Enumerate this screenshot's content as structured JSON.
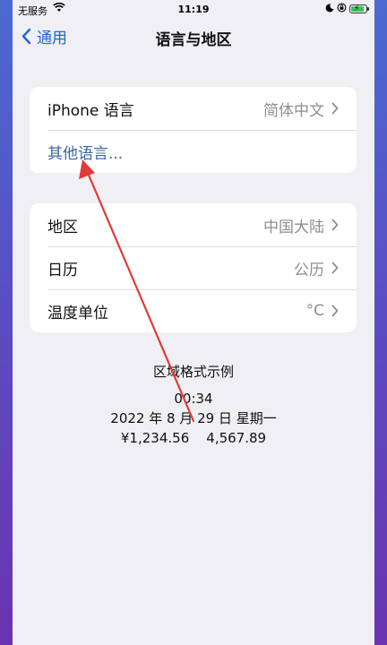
{
  "status_bar": {
    "carrier": "无服务",
    "time": "11:19",
    "battery_level": 0.85
  },
  "nav": {
    "back_label": "通用",
    "title": "语言与地区"
  },
  "language_group": {
    "rows": [
      {
        "label": "iPhone 语言",
        "value": "简体中文"
      },
      {
        "label": "其他语言..."
      }
    ]
  },
  "region_group": {
    "rows": [
      {
        "label": "地区",
        "value": "中国大陆"
      },
      {
        "label": "日历",
        "value": "公历"
      },
      {
        "label": "温度单位",
        "value": "°C"
      }
    ]
  },
  "format_example": {
    "title": "区域格式示例",
    "time": "00:34",
    "date": "2022 年 8 月 29 日 星期一",
    "numbers": "¥1,234.56    4,567.89"
  },
  "annotation": {
    "color": "#e03a3a",
    "icon": "red-arrow-pointing-to-other-languages"
  },
  "colors": {
    "accent": "#1f64d8",
    "link": "#3a68a6",
    "background": "#efeff4"
  }
}
